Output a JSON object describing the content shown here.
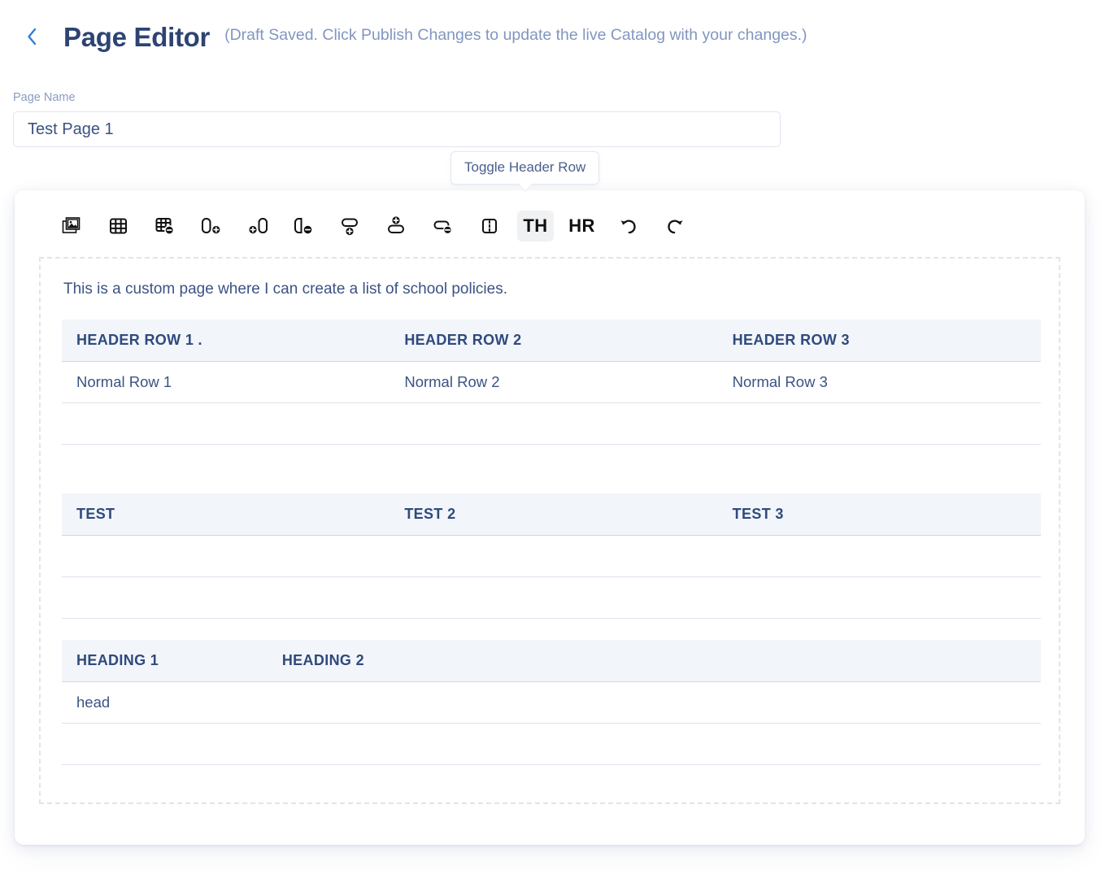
{
  "header": {
    "back_icon": "chevron-left-icon",
    "title": "Page Editor",
    "subtitle": "(Draft Saved. Click Publish Changes to update the live Catalog with your changes.)"
  },
  "page_name_field": {
    "label": "Page Name",
    "value": "Test Page 1",
    "placeholder": "Page Name"
  },
  "tooltip": {
    "text": "Toggle Header Row"
  },
  "toolbar": {
    "buttons": [
      {
        "name": "insert-image-icon",
        "label": "",
        "type": "icon",
        "active": false
      },
      {
        "name": "insert-table-icon",
        "label": "",
        "type": "icon",
        "active": false
      },
      {
        "name": "delete-table-icon",
        "label": "",
        "type": "icon",
        "active": false
      },
      {
        "name": "add-column-after-icon",
        "label": "",
        "type": "icon",
        "active": false
      },
      {
        "name": "add-column-before-icon",
        "label": "",
        "type": "icon",
        "active": false
      },
      {
        "name": "delete-column-icon",
        "label": "",
        "type": "icon",
        "active": false
      },
      {
        "name": "add-row-before-icon",
        "label": "",
        "type": "icon",
        "active": false
      },
      {
        "name": "add-row-after-icon",
        "label": "",
        "type": "icon",
        "active": false
      },
      {
        "name": "delete-row-icon",
        "label": "",
        "type": "icon",
        "active": false
      },
      {
        "name": "merge-split-cells-icon",
        "label": "",
        "type": "icon",
        "active": false
      },
      {
        "name": "toggle-header-row-button",
        "label": "TH",
        "type": "text",
        "active": true
      },
      {
        "name": "horizontal-rule-button",
        "label": "HR",
        "type": "text",
        "active": false
      },
      {
        "name": "undo-icon",
        "label": "",
        "type": "icon",
        "active": false
      },
      {
        "name": "redo-icon",
        "label": "",
        "type": "icon",
        "active": false
      }
    ],
    "th_label": "TH",
    "hr_label": "HR"
  },
  "editor": {
    "paragraph": "This is a custom page where I can create a list of school policies.",
    "tables": [
      {
        "name": "table-1",
        "columns": 3,
        "col_widths": [
          "33.5%",
          "33.5%",
          "33%"
        ],
        "headers": [
          "HEADER ROW 1 .",
          "HEADER ROW 2",
          "HEADER ROW 3"
        ],
        "rows": [
          [
            "Normal Row 1",
            "Normal Row 2",
            "Normal Row 3"
          ],
          [
            "",
            "",
            ""
          ]
        ]
      },
      {
        "name": "table-2",
        "columns": 3,
        "col_widths": [
          "33.5%",
          "33.5%",
          "33%"
        ],
        "headers": [
          "TEST",
          "TEST 2",
          "TEST 3"
        ],
        "rows": [
          [
            "",
            "",
            ""
          ],
          [
            "",
            "",
            ""
          ]
        ]
      },
      {
        "name": "table-3",
        "columns": 2,
        "col_widths": [
          "21%",
          "79%"
        ],
        "headers": [
          "HEADING 1",
          "HEADING 2"
        ],
        "rows": [
          [
            "head",
            ""
          ],
          [
            "",
            ""
          ]
        ]
      }
    ]
  },
  "colors": {
    "title": "#2d4373",
    "subtitle": "#8196bf",
    "accent": "#2f7fe0",
    "text": "#3b5384",
    "table_header_bg": "#f2f5f9",
    "dashed_border": "#e2e4e8",
    "active_btn_bg": "#f0f1f3"
  }
}
